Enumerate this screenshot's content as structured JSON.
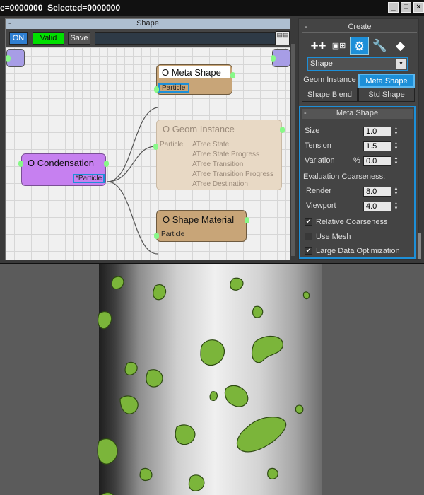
{
  "window": {
    "status_title": "e=0000000  Selected=0000000",
    "minimize": "_",
    "restore": "□",
    "close": "×"
  },
  "editor": {
    "title": "Shape",
    "collapse": "-",
    "toolbar": {
      "on_label": "ON",
      "valid_label": "Valid",
      "save_label": "Save"
    },
    "nodes": {
      "meta_shape": {
        "title": "O Meta Shape",
        "port": "Particle"
      },
      "geom_instance": {
        "title": "O Geom Instance",
        "port": "Particle",
        "outputs": [
          "ATree State",
          "ATree State Progress",
          "ATree Transition",
          "ATree Transition Progress",
          "ATree Destination"
        ]
      },
      "condensation": {
        "title": "O Condensation",
        "port": "*Particle"
      },
      "shape_material": {
        "title": "O Shape Material",
        "port": "Particle"
      }
    }
  },
  "panel": {
    "create_roll": {
      "collapse": "-",
      "title": "Create"
    },
    "icons": [
      "create-geometry-icon",
      "create-shapes-icon",
      "gear-icon",
      "wrench-icon",
      "cube-icon"
    ],
    "category_dropdown": {
      "value": "Shape",
      "arrow": "▼"
    },
    "types": [
      "Geom Instance",
      "Meta Shape",
      "Shape Blend",
      "Std Shape"
    ],
    "selected_type": "Meta Shape",
    "meta_roll": {
      "collapse": "-",
      "title": "Meta Shape",
      "size_label": "Size",
      "size_value": "1.0",
      "tension_label": "Tension",
      "tension_value": "1.5",
      "variation_label": "Variation",
      "variation_unit": "%",
      "variation_value": "0.0",
      "coarseness_label": "Evaluation Coarseness:",
      "render_label": "Render",
      "render_value": "8.0",
      "viewport_label": "Viewport",
      "viewport_value": "4.0",
      "relative_label": "Relative Coarseness",
      "use_mesh_label": "Use Mesh",
      "large_data_label": "Large Data Optimization",
      "checks": {
        "relative": true,
        "use_mesh": false,
        "large_data": true
      }
    }
  },
  "colors": {
    "accent": "#1d8fd8",
    "valid_green": "#00e000",
    "node_brown": "#c8a578",
    "node_purple": "#c680f0",
    "blob_green": "#7bb53a"
  }
}
